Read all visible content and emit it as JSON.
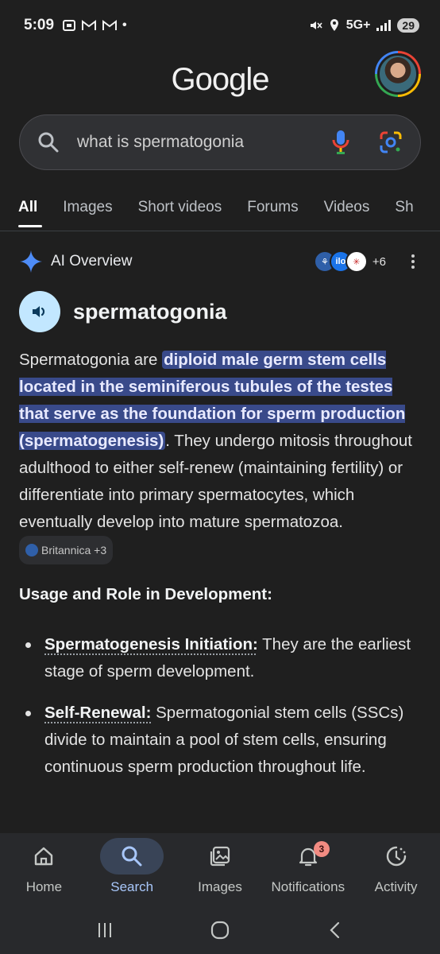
{
  "status_bar": {
    "time": "5:09",
    "network": "5G+",
    "battery": "29"
  },
  "header": {
    "logo": "Google"
  },
  "search": {
    "query": "what is spermatogonia"
  },
  "tabs": [
    {
      "label": "All"
    },
    {
      "label": "Images"
    },
    {
      "label": "Short videos"
    },
    {
      "label": "Forums"
    },
    {
      "label": "Videos"
    },
    {
      "label": "Sh"
    }
  ],
  "ai_overview": {
    "label": "AI Overview",
    "source_icon_text": "ilo",
    "sources_more": "+6",
    "heading": "spermatogonia",
    "para_start": "Spermatogonia are ",
    "para_highlight": "diploid male germ stem cells located in the seminiferous tubules of the testes that serve as the foundation for sperm production (spermatogenesis)",
    "para_rest": ". They undergo mitosis throughout adulthood to either self-renew (maintaining fertility) or differentiate into primary spermatocytes, which eventually develop into mature spermatozoa. ",
    "citation": "Britannica +3",
    "subheading": "Usage and Role in Development:",
    "bullets": [
      {
        "term": "Spermatogenesis Initiation:",
        "text": " They are the earliest stage of sperm development."
      },
      {
        "term": "Self-Renewal:",
        "text": " Spermatogonial stem cells (SSCs) divide to maintain a pool of stem cells, ensuring continuous sperm production throughout life."
      }
    ]
  },
  "bottom_nav": [
    {
      "label": "Home"
    },
    {
      "label": "Search"
    },
    {
      "label": "Images"
    },
    {
      "label": "Notifications",
      "badge": "3"
    },
    {
      "label": "Activity"
    }
  ],
  "colors": {
    "accent": "#a8c7fa",
    "highlight": "#394a8a",
    "background": "#1f1f1f"
  }
}
